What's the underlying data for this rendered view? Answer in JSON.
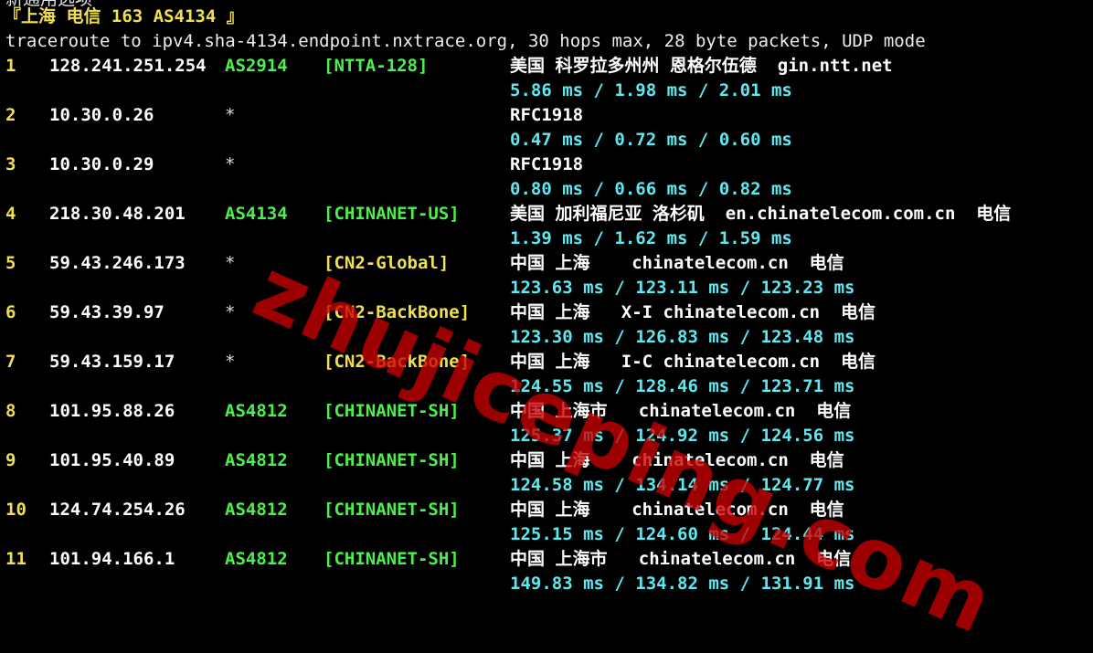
{
  "terminal": {
    "cut_line": "新通用选项",
    "header": "『上海 电信 163 AS4134 』",
    "traceroute_cmd": "traceroute to ipv4.sha-4134.endpoint.nxtrace.org, 30 hops max, 28 byte packets, UDP mode",
    "hops": [
      {
        "num": "1",
        "ip": "128.241.251.254",
        "as": "AS2914",
        "tag": "[NTTA-128]",
        "tag_color": "green",
        "geo": "美国 科罗拉多州州 恩格尔伍德  gin.ntt.net",
        "times": "5.86 ms / 1.98 ms / 2.01 ms"
      },
      {
        "num": "2",
        "ip": "10.30.0.26",
        "as": "*",
        "tag": "",
        "tag_color": "",
        "geo": "RFC1918",
        "times": "0.47 ms / 0.72 ms / 0.60 ms"
      },
      {
        "num": "3",
        "ip": "10.30.0.29",
        "as": "*",
        "tag": "",
        "tag_color": "",
        "geo": "RFC1918",
        "times": "0.80 ms / 0.66 ms / 0.82 ms"
      },
      {
        "num": "4",
        "ip": "218.30.48.201",
        "as": "AS4134",
        "tag": "[CHINANET-US]",
        "tag_color": "green",
        "geo": "美国 加利福尼亚 洛杉矶  en.chinatelecom.com.cn  电信",
        "times": "1.39 ms / 1.62 ms / 1.59 ms"
      },
      {
        "num": "5",
        "ip": "59.43.246.173",
        "as": "*",
        "tag": "[CN2-Global]",
        "tag_color": "yellow",
        "geo": "中国 上海    chinatelecom.cn  电信",
        "times": "123.63 ms / 123.11 ms / 123.23 ms"
      },
      {
        "num": "6",
        "ip": "59.43.39.97",
        "as": "*",
        "tag": "[CN2-BackBone]",
        "tag_color": "yellow",
        "geo": "中国 上海   X-I chinatelecom.cn  电信",
        "times": "123.30 ms / 126.83 ms / 123.48 ms"
      },
      {
        "num": "7",
        "ip": "59.43.159.17",
        "as": "*",
        "tag": "[CN2-BackBone]",
        "tag_color": "yellow",
        "geo": "中国 上海   I-C chinatelecom.cn  电信",
        "times": "124.55 ms / 128.46 ms / 123.71 ms"
      },
      {
        "num": "8",
        "ip": "101.95.88.26",
        "as": "AS4812",
        "tag": "[CHINANET-SH]",
        "tag_color": "green",
        "geo": "中国 上海市   chinatelecom.cn  电信",
        "times": "125.37 ms / 124.92 ms / 124.56 ms"
      },
      {
        "num": "9",
        "ip": "101.95.40.89",
        "as": "AS4812",
        "tag": "[CHINANET-SH]",
        "tag_color": "green",
        "geo": "中国 上海    chinatelecom.cn  电信",
        "times": "124.58 ms / 134.14 ms / 124.77 ms"
      },
      {
        "num": "10",
        "ip": "124.74.254.26",
        "as": "AS4812",
        "tag": "[CHINANET-SH]",
        "tag_color": "green",
        "geo": "中国 上海    chinatelecom.cn  电信",
        "times": "125.15 ms / 124.60 ms / 124.44 ms"
      },
      {
        "num": "11",
        "ip": "101.94.166.1",
        "as": "AS4812",
        "tag": "[CHINANET-SH]",
        "tag_color": "green",
        "geo": "中国 上海市   chinatelecom.cn  电信",
        "times": "149.83 ms / 134.82 ms / 131.91 ms"
      }
    ]
  },
  "watermark": {
    "text": "zhujiceping.com",
    "color": "#c80000"
  },
  "colors": {
    "background": "#000000",
    "hop_number": "#f0e050",
    "as_green": "#4cf04c",
    "tag_yellow": "#f0e050",
    "latency_cyan": "#5ee8f0",
    "text_white": "#ffffff"
  }
}
